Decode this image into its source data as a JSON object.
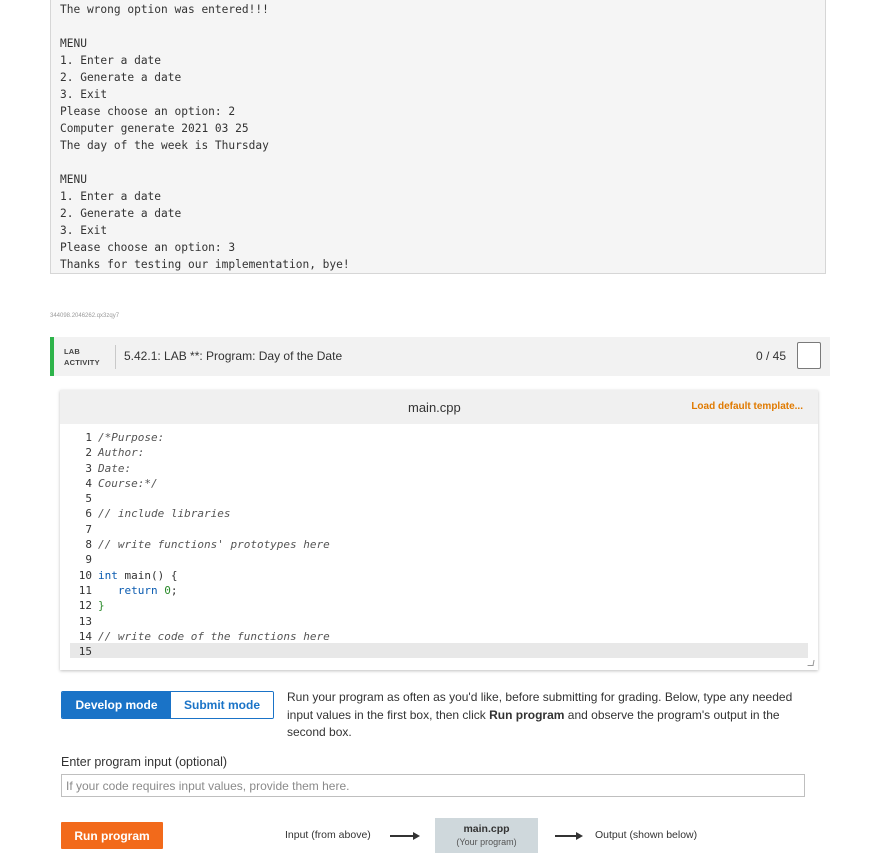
{
  "console": {
    "lines": [
      "The wrong option was entered!!!",
      "",
      "MENU",
      "1. Enter a date",
      "2. Generate a date",
      "3. Exit",
      "Please choose an option: 2",
      "Computer generate 2021 03 25",
      "The day of the week is Thursday",
      "",
      "MENU",
      "1. Enter a date",
      "2. Generate a date",
      "3. Exit",
      "Please choose an option: 3",
      "Thanks for testing our implementation, bye!"
    ]
  },
  "lab": {
    "id_text": "344098.2046262.qx3zqy7",
    "tag_line1": "LAB",
    "tag_line2": "ACTIVITY",
    "title": "5.42.1: LAB **: Program: Day of the Date",
    "score": "0 / 45"
  },
  "editor": {
    "file_name": "main.cpp",
    "load_template": "Load default template...",
    "line_numbers": [
      "1",
      "2",
      "3",
      "4",
      "5",
      "6",
      "7",
      "8",
      "9",
      "10",
      "11",
      "12",
      "13",
      "14",
      "15"
    ],
    "code": {
      "l1": "/*Purpose:",
      "l2": "Author:",
      "l3": "Date:",
      "l4": "Course:*/",
      "l6": "// include libraries",
      "l8": "// write functions' prototypes here",
      "l10_kw": "int",
      "l10_rest": " main() {",
      "l11_kw": "return",
      "l11_num": "0",
      "l11_end": ";",
      "l12": "}",
      "l14": "// write code of the functions here"
    }
  },
  "modes": {
    "develop": "Develop mode",
    "submit": "Submit mode"
  },
  "instructions": {
    "part1": "Run your program as often as you'd like, before submitting for grading. Below, type any needed input values in the first box, then click ",
    "bold1": "Run program",
    "part2": " and observe the program's output in the second box."
  },
  "input": {
    "label": "Enter program input (optional)",
    "placeholder": "If your code requires input values, provide them here."
  },
  "run": {
    "label": "Run program"
  },
  "flow": {
    "input_label": "Input (from above)",
    "box_title": "main.cpp",
    "box_sub": "(Your program)",
    "output_label": "Output (shown below)"
  },
  "colors": {
    "accent_green": "#2db34a",
    "develop_blue": "#1a73c7",
    "run_orange": "#f26a1b",
    "load_orange": "#e07a00"
  }
}
